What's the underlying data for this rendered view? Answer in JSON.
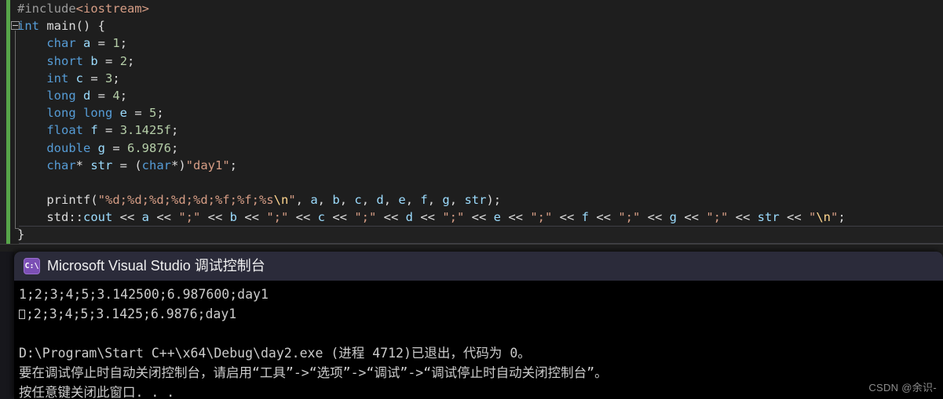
{
  "editor": {
    "name": "visual-studio-code-editor",
    "theme_bg": "#1e1e1e",
    "change_bar_color": "#57a64a",
    "lines": [
      {
        "id": 1,
        "tokens": [
          {
            "t": "#include",
            "c": "pp"
          },
          {
            "t": "<iostream>",
            "c": "str"
          }
        ]
      },
      {
        "id": 2,
        "tokens": [
          {
            "t": "int",
            "c": "kw"
          },
          {
            "t": " ",
            "c": "pun"
          },
          {
            "t": "main",
            "c": "fn"
          },
          {
            "t": "() {",
            "c": "pun"
          }
        ]
      },
      {
        "id": 3,
        "tokens": [
          {
            "t": "    ",
            "c": "pun"
          },
          {
            "t": "char",
            "c": "kw"
          },
          {
            "t": " ",
            "c": "pun"
          },
          {
            "t": "a",
            "c": "var"
          },
          {
            "t": " = ",
            "c": "pun"
          },
          {
            "t": "1",
            "c": "num"
          },
          {
            "t": ";",
            "c": "pun"
          }
        ]
      },
      {
        "id": 4,
        "tokens": [
          {
            "t": "    ",
            "c": "pun"
          },
          {
            "t": "short",
            "c": "kw"
          },
          {
            "t": " ",
            "c": "pun"
          },
          {
            "t": "b",
            "c": "var"
          },
          {
            "t": " = ",
            "c": "pun"
          },
          {
            "t": "2",
            "c": "num"
          },
          {
            "t": ";",
            "c": "pun"
          }
        ]
      },
      {
        "id": 5,
        "tokens": [
          {
            "t": "    ",
            "c": "pun"
          },
          {
            "t": "int",
            "c": "kw"
          },
          {
            "t": " ",
            "c": "pun"
          },
          {
            "t": "c",
            "c": "var"
          },
          {
            "t": " = ",
            "c": "pun"
          },
          {
            "t": "3",
            "c": "num"
          },
          {
            "t": ";",
            "c": "pun"
          }
        ]
      },
      {
        "id": 6,
        "tokens": [
          {
            "t": "    ",
            "c": "pun"
          },
          {
            "t": "long",
            "c": "kw"
          },
          {
            "t": " ",
            "c": "pun"
          },
          {
            "t": "d",
            "c": "var"
          },
          {
            "t": " = ",
            "c": "pun"
          },
          {
            "t": "4",
            "c": "num"
          },
          {
            "t": ";",
            "c": "pun"
          }
        ]
      },
      {
        "id": 7,
        "tokens": [
          {
            "t": "    ",
            "c": "pun"
          },
          {
            "t": "long long",
            "c": "kw"
          },
          {
            "t": " ",
            "c": "pun"
          },
          {
            "t": "e",
            "c": "var"
          },
          {
            "t": " = ",
            "c": "pun"
          },
          {
            "t": "5",
            "c": "num"
          },
          {
            "t": ";",
            "c": "pun"
          }
        ]
      },
      {
        "id": 8,
        "tokens": [
          {
            "t": "    ",
            "c": "pun"
          },
          {
            "t": "float",
            "c": "kw"
          },
          {
            "t": " ",
            "c": "pun"
          },
          {
            "t": "f",
            "c": "var"
          },
          {
            "t": " = ",
            "c": "pun"
          },
          {
            "t": "3.1425f",
            "c": "num"
          },
          {
            "t": ";",
            "c": "pun"
          }
        ]
      },
      {
        "id": 9,
        "tokens": [
          {
            "t": "    ",
            "c": "pun"
          },
          {
            "t": "double",
            "c": "kw"
          },
          {
            "t": " ",
            "c": "pun"
          },
          {
            "t": "g",
            "c": "var"
          },
          {
            "t": " = ",
            "c": "pun"
          },
          {
            "t": "6.9876",
            "c": "num"
          },
          {
            "t": ";",
            "c": "pun"
          }
        ]
      },
      {
        "id": 10,
        "tokens": [
          {
            "t": "    ",
            "c": "pun"
          },
          {
            "t": "char",
            "c": "kw"
          },
          {
            "t": "* ",
            "c": "pun"
          },
          {
            "t": "str",
            "c": "var"
          },
          {
            "t": " = (",
            "c": "pun"
          },
          {
            "t": "char",
            "c": "kw"
          },
          {
            "t": "*)",
            "c": "pun"
          },
          {
            "t": "\"day1\"",
            "c": "str"
          },
          {
            "t": ";",
            "c": "pun"
          }
        ]
      },
      {
        "id": 11,
        "tokens": [
          {
            "t": "",
            "c": "pun"
          }
        ]
      },
      {
        "id": 12,
        "tokens": [
          {
            "t": "    ",
            "c": "pun"
          },
          {
            "t": "printf",
            "c": "fn"
          },
          {
            "t": "(",
            "c": "pun"
          },
          {
            "t": "\"%d;%d;%d;%d;%d;%f;%f;%s",
            "c": "str"
          },
          {
            "t": "\\n",
            "c": "esc"
          },
          {
            "t": "\"",
            "c": "str"
          },
          {
            "t": ", ",
            "c": "pun"
          },
          {
            "t": "a",
            "c": "var"
          },
          {
            "t": ", ",
            "c": "pun"
          },
          {
            "t": "b",
            "c": "var"
          },
          {
            "t": ", ",
            "c": "pun"
          },
          {
            "t": "c",
            "c": "var"
          },
          {
            "t": ", ",
            "c": "pun"
          },
          {
            "t": "d",
            "c": "var"
          },
          {
            "t": ", ",
            "c": "pun"
          },
          {
            "t": "e",
            "c": "var"
          },
          {
            "t": ", ",
            "c": "pun"
          },
          {
            "t": "f",
            "c": "var"
          },
          {
            "t": ", ",
            "c": "pun"
          },
          {
            "t": "g",
            "c": "var"
          },
          {
            "t": ", ",
            "c": "pun"
          },
          {
            "t": "str",
            "c": "var"
          },
          {
            "t": ");",
            "c": "pun"
          }
        ]
      },
      {
        "id": 13,
        "tokens": [
          {
            "t": "    ",
            "c": "pun"
          },
          {
            "t": "std",
            "c": "ns"
          },
          {
            "t": "::",
            "c": "pun"
          },
          {
            "t": "cout",
            "c": "var"
          },
          {
            "t": " << ",
            "c": "pun"
          },
          {
            "t": "a",
            "c": "var"
          },
          {
            "t": " << ",
            "c": "pun"
          },
          {
            "t": "\";\"",
            "c": "str"
          },
          {
            "t": " << ",
            "c": "pun"
          },
          {
            "t": "b",
            "c": "var"
          },
          {
            "t": " << ",
            "c": "pun"
          },
          {
            "t": "\";\"",
            "c": "str"
          },
          {
            "t": " << ",
            "c": "pun"
          },
          {
            "t": "c",
            "c": "var"
          },
          {
            "t": " << ",
            "c": "pun"
          },
          {
            "t": "\";\"",
            "c": "str"
          },
          {
            "t": " << ",
            "c": "pun"
          },
          {
            "t": "d",
            "c": "var"
          },
          {
            "t": " << ",
            "c": "pun"
          },
          {
            "t": "\";\"",
            "c": "str"
          },
          {
            "t": " << ",
            "c": "pun"
          },
          {
            "t": "e",
            "c": "var"
          },
          {
            "t": " << ",
            "c": "pun"
          },
          {
            "t": "\";\"",
            "c": "str"
          },
          {
            "t": " << ",
            "c": "pun"
          },
          {
            "t": "f",
            "c": "var"
          },
          {
            "t": " << ",
            "c": "pun"
          },
          {
            "t": "\";\"",
            "c": "str"
          },
          {
            "t": " << ",
            "c": "pun"
          },
          {
            "t": "g",
            "c": "var"
          },
          {
            "t": " << ",
            "c": "pun"
          },
          {
            "t": "\";\"",
            "c": "str"
          },
          {
            "t": " << ",
            "c": "pun"
          },
          {
            "t": "str",
            "c": "var"
          },
          {
            "t": " << ",
            "c": "pun"
          },
          {
            "t": "\"",
            "c": "str"
          },
          {
            "t": "\\n",
            "c": "esc"
          },
          {
            "t": "\"",
            "c": "str"
          },
          {
            "t": ";",
            "c": "pun"
          }
        ]
      },
      {
        "id": 14,
        "tokens": [
          {
            "t": "}",
            "c": "pun"
          }
        ]
      }
    ],
    "fold_marker": "collapse-minus"
  },
  "console": {
    "icon_name": "cmd-console-icon",
    "icon_glyph": "C:\\",
    "title": "Microsoft Visual Studio 调试控制台",
    "output_lines": [
      {
        "kind": "text",
        "text": "1;2;3;4;5;3.142500;6.987600;day1"
      },
      {
        "kind": "ctrl",
        "text": ";2;3;4;5;3.1425;6.9876;day1"
      },
      {
        "kind": "blank",
        "text": ""
      },
      {
        "kind": "text",
        "text": "D:\\Program\\Start C++\\x64\\Debug\\day2.exe (进程 4712)已退出，代码为 0。"
      },
      {
        "kind": "text",
        "text": "要在调试停止时自动关闭控制台，请启用“工具”->“选项”->“调试”->“调试停止时自动关闭控制台”。"
      },
      {
        "kind": "text",
        "text": "按任意键关闭此窗口. . ."
      }
    ]
  },
  "watermark": {
    "text": "CSDN @余识-"
  }
}
